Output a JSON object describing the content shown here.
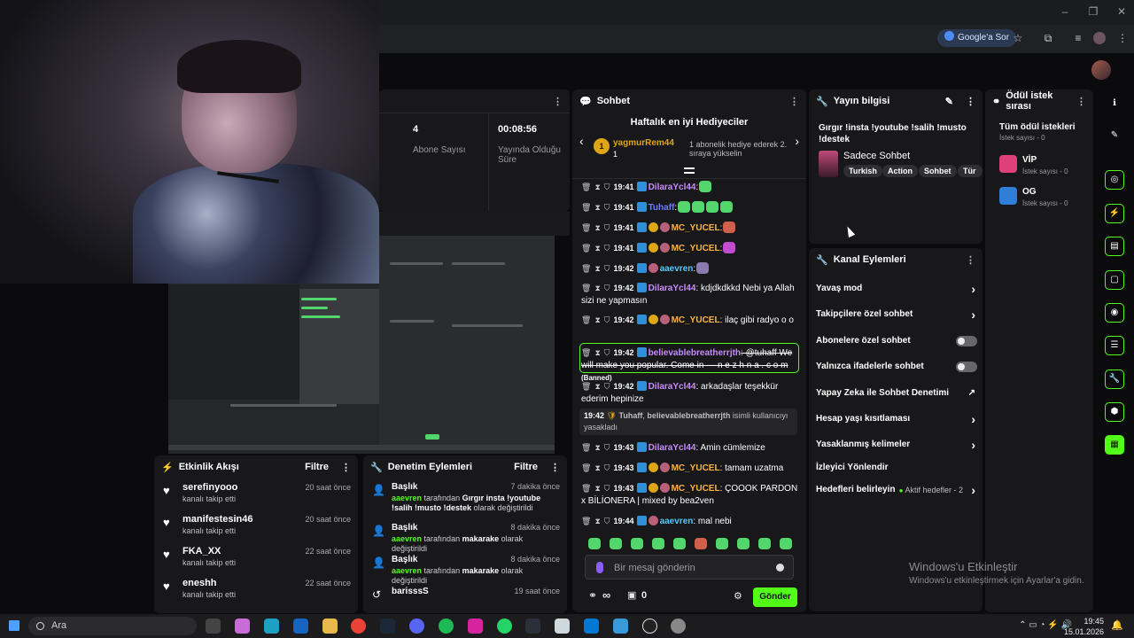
{
  "browser": {
    "assistant_chip": "Google'a Sor"
  },
  "stats": {
    "menu": "⋮",
    "items": [
      {
        "value": "4",
        "label": "Abone Sayısı"
      },
      {
        "value": "00:08:56",
        "label": "Yayında Olduğu Süre"
      }
    ]
  },
  "activity": {
    "title": "Etkinlik Akışı",
    "filter": "Filtre",
    "items": [
      {
        "name": "serefinyooo",
        "sub": "kanalı takip etti",
        "time": "20 saat önce"
      },
      {
        "name": "manifestesin46",
        "sub": "kanalı takip etti",
        "time": "20 saat önce"
      },
      {
        "name": "FKA_XX",
        "sub": "kanalı takip etti",
        "time": "22 saat önce"
      },
      {
        "name": "eneshh",
        "sub": "kanalı takip etti",
        "time": "22 saat önce"
      }
    ]
  },
  "moderation": {
    "title": "Denetim Eylemleri",
    "filter": "Filtre",
    "items": [
      {
        "name": "Başlık",
        "actor": "aaevren",
        "mid": "tarafından",
        "value": "Gırgır insta !youtube !salih !musto !destek",
        "tail": "olarak değiştirildi",
        "time": "7 dakika önce"
      },
      {
        "name": "Başlık",
        "actor": "aaevren",
        "mid": "tarafından",
        "value": "makarake",
        "tail": "olarak değiştirildi",
        "time": "8 dakika önce"
      },
      {
        "name": "Başlık",
        "actor": "aaevren",
        "mid": "tarafından",
        "value": "makarake",
        "tail": "olarak değiştirildi",
        "time": "8 dakika önce"
      },
      {
        "name": "barisssS",
        "actor": "",
        "mid": "",
        "value": "",
        "tail": "",
        "time": "19 saat önce"
      }
    ]
  },
  "chat": {
    "title": "Sohbet",
    "gifters_title": "Haftalık en iyi Hediyeciler",
    "top_gifter": {
      "rank": "1",
      "name": "yagmurRem44",
      "count": "1",
      "desc": "1 abonelik hediye ederek 2. sıraya yükselin"
    },
    "messages": [
      {
        "time": "19:41",
        "user": "DilaraYcl44",
        "cls": "u1",
        "text": ":",
        "emotes": 1
      },
      {
        "time": "19:41",
        "user": "Tuhaff",
        "cls": "u3",
        "text": ":",
        "emotes": 4
      },
      {
        "time": "19:41",
        "user": "MC_YUCEL",
        "cls": "u2",
        "text": ":",
        "emotes": 1
      },
      {
        "time": "19:41",
        "user": "MC_YUCEL",
        "cls": "u2",
        "text": ":",
        "emotes": 1
      },
      {
        "time": "19:42",
        "user": "aaevren",
        "cls": "u4",
        "text": ":",
        "emotes": 1
      },
      {
        "time": "19:42",
        "user": "DilaraYcl44",
        "cls": "u1",
        "text": ": kdjdkdkkd Nebi ya Allah sizi ne yapmasın",
        "emotes": 0
      },
      {
        "time": "19:42",
        "user": "MC_YUCEL",
        "cls": "u2",
        "text": ": ilaç gibi radyo o o",
        "emotes": 0
      },
      {
        "time": "19:42",
        "user": "believablebreatherrjth",
        "cls": "u1",
        "text": ": @tuhaff We will make you popular. Come in — n e z h n a . c o m",
        "emotes": 0,
        "tag": "(Banned)"
      },
      {
        "time": "19:42",
        "user": "DilaraYcl44",
        "cls": "u1",
        "text": ": arkadaşlar teşekkür ederim hepinize",
        "emotes": 0
      },
      {
        "time": "19:43",
        "user": "DilaraYcl44",
        "cls": "u1",
        "text": ": Amin cümlemize",
        "emotes": 0
      },
      {
        "time": "19:43",
        "user": "MC_YUCEL",
        "cls": "u2",
        "text": ": tamam uzatma",
        "emotes": 0
      },
      {
        "time": "19:43",
        "user": "MC_YUCEL",
        "cls": "u2",
        "text": ": ÇOOOK PARDON x BİLİONERA | mixed by bea2ven",
        "emotes": 0
      },
      {
        "time": "19:44",
        "user": "aaevren",
        "cls": "u4",
        "text": ": mal nebi",
        "emotes": 0
      }
    ],
    "system": {
      "time": "19:42",
      "actor": "Tuhaff",
      "target": "believablebreatherrjth",
      "text": "isimli kullanıcıyı yasakladı"
    },
    "input_placeholder": "Bir mesaj gönderin",
    "infinity": "∞",
    "points": "0",
    "send": "Gönder"
  },
  "info": {
    "title": "Yayın bilgisi",
    "stream_title": "Gırgır !insta !youtube !salih !musto !destek",
    "category": "Sadece Sohbet",
    "tags": [
      "Turkish",
      "Action",
      "Sohbet",
      "Tür"
    ]
  },
  "actions": {
    "title": "Kanal Eylemleri",
    "items": [
      {
        "label": "Yavaş mod",
        "type": "chevron"
      },
      {
        "label": "Takipçilere özel sohbet",
        "type": "chevron"
      },
      {
        "label": "Abonelere özel sohbet",
        "type": "toggle"
      },
      {
        "label": "Yalnızca ifadelerle sohbet",
        "type": "toggle"
      },
      {
        "label": "Yapay Zeka ile Sohbet Denetimi",
        "type": "ext"
      },
      {
        "label": "Hesap yaşı kısıtlaması",
        "type": "chevron"
      },
      {
        "label": "Yasaklanmış kelimeler",
        "type": "chevron"
      },
      {
        "label": "İzleyici Yönlendir",
        "type": "none"
      },
      {
        "label": "Hedefleri belirleyin",
        "type": "chevron",
        "note": "Aktif hedefler - 2"
      }
    ]
  },
  "rewards": {
    "title": "Ödül istek sırası",
    "all": "Tüm ödül istekleri",
    "all_sub": "İstek sayısı - 0",
    "items": [
      {
        "name": "VİP",
        "sub": "İstek sayısı - 0",
        "color": "#e0407a"
      },
      {
        "name": "OG",
        "sub": "İstek sayısı - 0",
        "color": "#2f7fd8"
      }
    ]
  },
  "windows": {
    "activate": "Windows'u Etkinleştir",
    "activate_sub": "Windows'u etkinleştirmek için Ayarlar'a gidin.",
    "search": "Ara",
    "time": "19:45",
    "date": "15.01.2026"
  },
  "colors": {
    "accent": "#53fc18",
    "panel": "#18181b"
  }
}
